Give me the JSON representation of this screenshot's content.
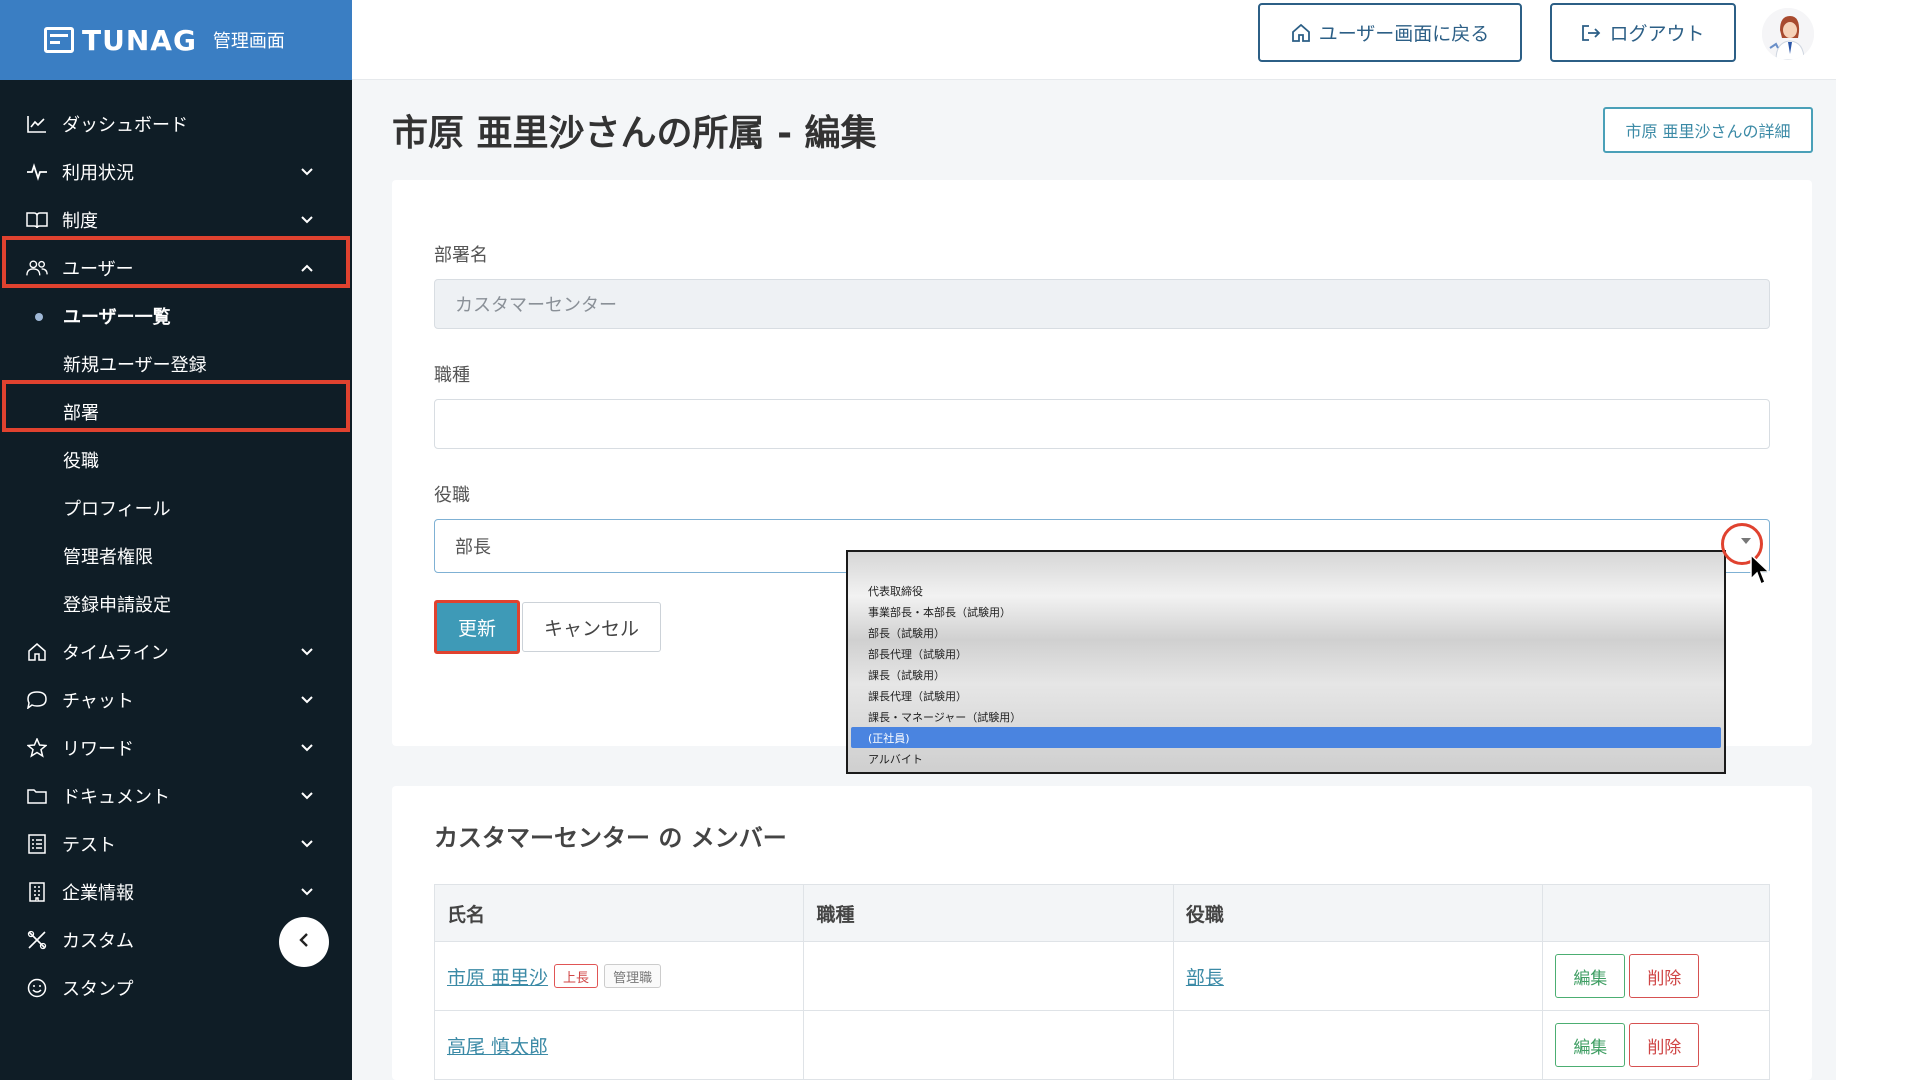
{
  "brand": {
    "name": "TUNAG",
    "subtitle": "管理画面"
  },
  "sidebar": {
    "items": [
      {
        "label": "ダッシュボード",
        "icon": "chart-line-icon",
        "chevron": ""
      },
      {
        "label": "利用状況",
        "icon": "activity-icon",
        "chevron": "down"
      },
      {
        "label": "制度",
        "icon": "book-icon",
        "chevron": "down"
      },
      {
        "label": "ユーザー",
        "icon": "users-icon",
        "chevron": "up"
      },
      {
        "label": "タイムライン",
        "icon": "home-icon",
        "chevron": "down"
      },
      {
        "label": "チャット",
        "icon": "chat-bubble-icon",
        "chevron": "down"
      },
      {
        "label": "リワード",
        "icon": "star-icon",
        "chevron": "down"
      },
      {
        "label": "ドキュメント",
        "icon": "folder-icon",
        "chevron": "down"
      },
      {
        "label": "テスト",
        "icon": "checklist-icon",
        "chevron": "down"
      },
      {
        "label": "企業情報",
        "icon": "building-icon",
        "chevron": "down"
      },
      {
        "label": "カスタム",
        "icon": "tools-icon",
        "chevron": ""
      },
      {
        "label": "スタンプ",
        "icon": "smile-icon",
        "chevron": ""
      }
    ],
    "user_submenu": [
      {
        "label": "ユーザー一覧",
        "active": true
      },
      {
        "label": "新規ユーザー登録",
        "active": false
      },
      {
        "label": "部署",
        "active": false
      },
      {
        "label": "役職",
        "active": false
      },
      {
        "label": "プロフィール",
        "active": false
      },
      {
        "label": "管理者権限",
        "active": false
      },
      {
        "label": "登録申請設定",
        "active": false
      }
    ]
  },
  "header": {
    "back_to_user": "ユーザー画面に戻る",
    "logout": "ログアウト"
  },
  "page": {
    "title": "市原 亜里沙さんの所属 - 編集",
    "detail_button": "市原 亜里沙さんの詳細"
  },
  "form": {
    "department_label": "部署名",
    "department_value": "カスタマーセンター",
    "job_type_label": "職種",
    "job_type_value": "",
    "position_label": "役職",
    "position_value": "部長",
    "update_button": "更新",
    "cancel_button": "キャンセル"
  },
  "dropdown": {
    "options": [
      "代表取締役",
      "事業部長・本部長（試験用）",
      "部長（試験用）",
      "部長代理（試験用）",
      "課長（試験用）",
      "課長代理（試験用）",
      "課長・マネージャー（試験用）",
      "(正社員)",
      "アルバイト"
    ],
    "selected_index": 7
  },
  "members": {
    "title": "カスタマーセンター の メンバー",
    "columns": [
      "氏名",
      "職種",
      "役職",
      ""
    ],
    "rows": [
      {
        "name": "市原 亜里沙",
        "tags": [
          "上長",
          "管理職"
        ],
        "job_type": "",
        "position": "部長",
        "edit": "編集",
        "delete": "削除"
      },
      {
        "name": "高尾 慎太郎",
        "tags": [],
        "job_type": "",
        "position": "",
        "edit": "編集",
        "delete": "削除"
      }
    ]
  },
  "colors": {
    "sidebar_bg": "#0f1d26",
    "brand_bg": "#3a7ec3",
    "primary": "#3e9ab7",
    "highlight": "#e0422f",
    "header_button": "#2c5f86"
  }
}
